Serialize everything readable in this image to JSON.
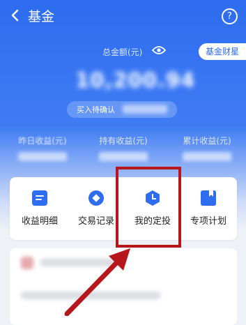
{
  "header": {
    "title": "基金",
    "back_icon": "chevron-left-icon",
    "help_icon": "question-circle-icon",
    "help_glyph": "?"
  },
  "summary": {
    "total_label": "总金额(元)",
    "visibility_icon": "eye-icon",
    "fortune_button": "基金财星",
    "total_value": "10,200.94",
    "pending_label": "买入待确认"
  },
  "stats": [
    {
      "label": "昨日收益(元)"
    },
    {
      "label": "持有收益(元)"
    },
    {
      "label": "累计收益(元)"
    }
  ],
  "actions": [
    {
      "label": "收益明细",
      "icon": "document-icon"
    },
    {
      "label": "交易记录",
      "icon": "record-icon"
    },
    {
      "label": "我的定投",
      "icon": "clock-icon"
    },
    {
      "label": "专项计划",
      "icon": "bookmark-icon"
    }
  ],
  "colors": {
    "primary": "#2e6cf0",
    "annotation": "#b8161d"
  }
}
